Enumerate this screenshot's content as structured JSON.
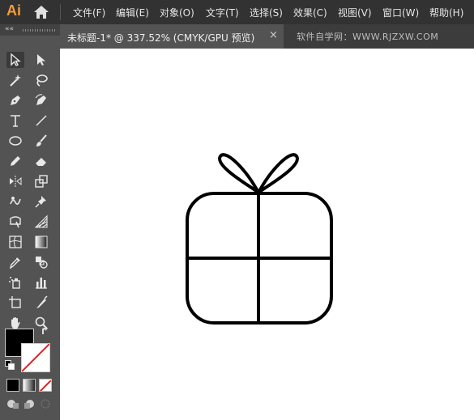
{
  "app": {
    "logo": "Ai",
    "menu": [
      "文件(F)",
      "编辑(E)",
      "对象(O)",
      "文字(T)",
      "选择(S)",
      "效果(C)",
      "视图(V)",
      "窗口(W)",
      "帮助(H)"
    ]
  },
  "document": {
    "tab_label": "未标题-1* @ 337.52% (CMYK/GPU 预览)",
    "close": "×"
  },
  "watermark": "软件自学网：WWW.RJZXW.COM",
  "toolbar": {
    "collapse": "««",
    "tools": [
      "selection-tool",
      "direct-selection-tool",
      "magic-wand-tool",
      "lasso-tool",
      "pen-tool",
      "curvature-tool",
      "type-tool",
      "line-segment-tool",
      "ellipse-tool",
      "paintbrush-tool",
      "shaper-tool",
      "eraser-tool",
      "reflect-tool",
      "scale-tool",
      "warp-tool",
      "puppet-warp-tool",
      "free-transform-tool",
      "perspective-grid-tool",
      "mesh-tool",
      "gradient-tool",
      "eyedropper-tool",
      "blend-tool",
      "symbol-sprayer-tool",
      "column-graph-tool",
      "artboard-tool",
      "slice-tool",
      "hand-tool",
      "zoom-tool"
    ],
    "fill_color": "#000000",
    "stroke_color": "#ffffff"
  },
  "colors": {
    "menubar": "#323232",
    "panel": "#535353",
    "logo": "#f29a3a",
    "canvas": "#ffffff",
    "artwork_stroke": "#000000"
  }
}
